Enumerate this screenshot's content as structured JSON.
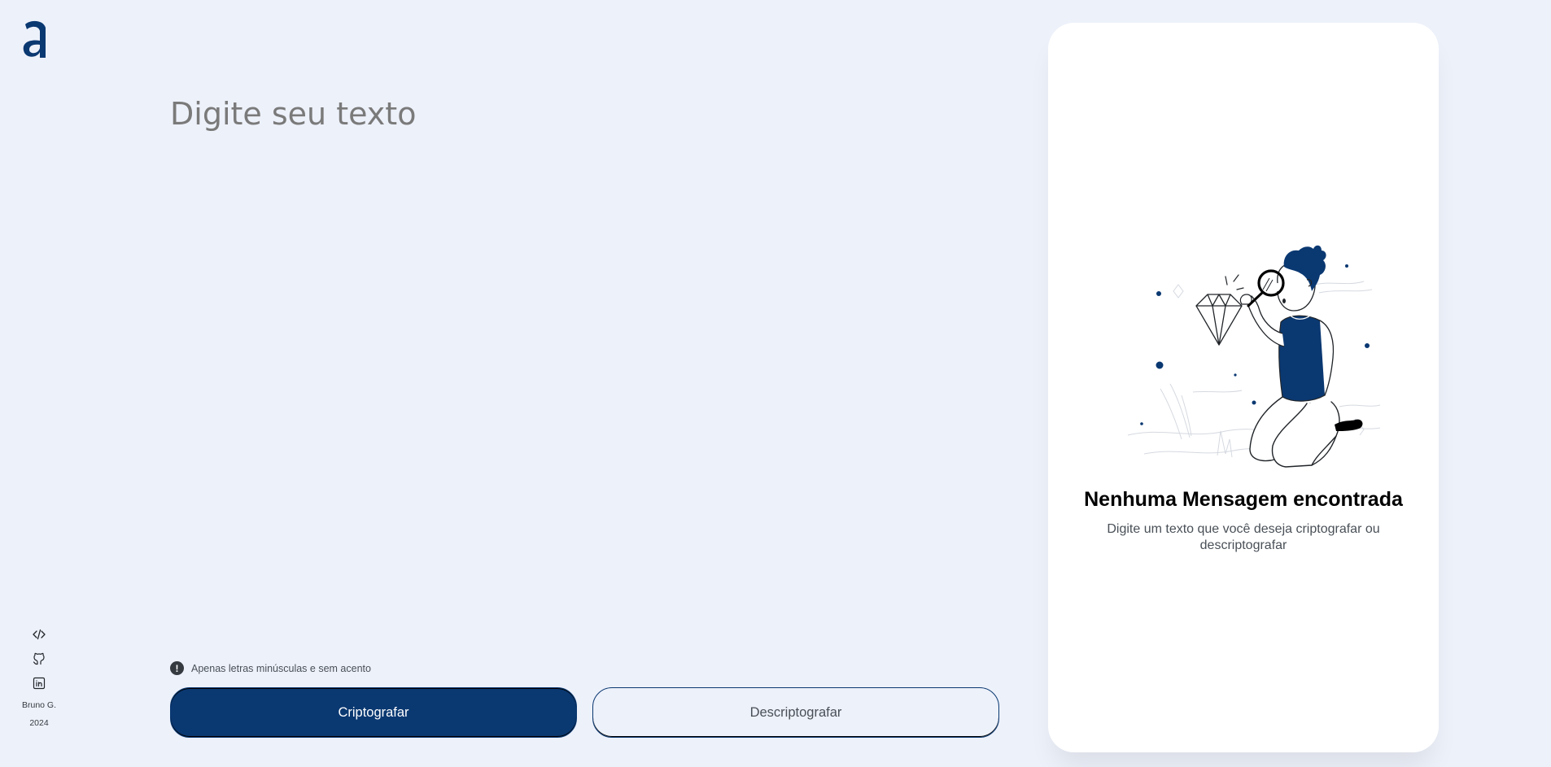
{
  "textarea": {
    "placeholder": "Digite seu texto",
    "value": ""
  },
  "hint": {
    "icon": "alert-circle-icon",
    "text": "Apenas letras minúsculas e sem acento"
  },
  "buttons": {
    "encrypt_label": "Criptografar",
    "decrypt_label": "Descriptografar"
  },
  "sidebar": {
    "logo": "alura-logo",
    "links": [
      {
        "icon": "code-icon"
      },
      {
        "icon": "github-icon"
      },
      {
        "icon": "linkedin-icon"
      }
    ],
    "author": "Bruno G.",
    "year": "2024"
  },
  "output_panel": {
    "illustration": "person-with-magnifying-glass-and-diamond",
    "title": "Nenhuma Mensagem encontrada",
    "description": "Digite um texto que você deseja criptografar ou descriptografar"
  },
  "colors": {
    "background": "#EDF1FA",
    "primary": "#0A3871",
    "panel": "#FFFFFF",
    "placeholder": "#7A7A7A"
  }
}
